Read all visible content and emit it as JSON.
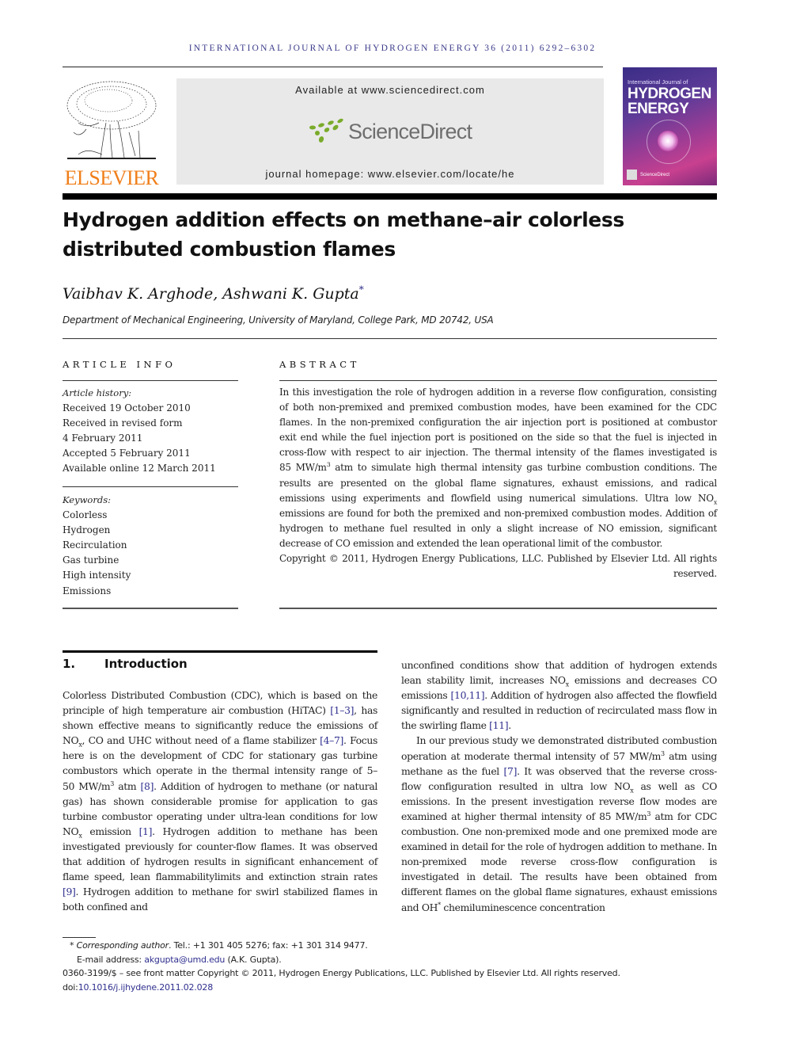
{
  "journal_header": {
    "running_head": "INTERNATIONAL JOURNAL OF HYDROGEN ENERGY 36 (2011) 6292–6302",
    "publisher_logo_text": "ELSEVIER",
    "available_at": "Available at www.sciencedirect.com",
    "sciencedirect_logo_text": "ScienceDirect",
    "journal_homepage": "journal homepage: www.elsevier.com/locate/he",
    "cover": {
      "line1": "International Journal of",
      "line2": "HYDROGEN",
      "line3": "ENERGY",
      "footer": "ScienceDirect"
    },
    "colors": {
      "running_head": "#3b3b8a",
      "elsevier_orange": "#f07f1a",
      "sciencedirect_green": "#7aab2a",
      "sciencedirect_gray": "#6e6e6e",
      "link_blue": "#2f2f8f"
    }
  },
  "article": {
    "title_line1": "Hydrogen addition effects on methane–air colorless",
    "title_line2": "distributed combustion flames",
    "authors": "Vaibhav K. Arghode, Ashwani K. Gupta",
    "corresponding_marker": "*",
    "affiliation": "Department of Mechanical Engineering, University of Maryland, College Park, MD 20742, USA"
  },
  "article_info": {
    "heading": "ARTICLE INFO",
    "history_label": "Article history:",
    "history": [
      "Received 19 October 2010",
      "Received in revised form",
      "4 February 2011",
      "Accepted 5 February 2011",
      "Available online 12 March 2011"
    ],
    "keywords_label": "Keywords:",
    "keywords": [
      "Colorless",
      "Hydrogen",
      "Recirculation",
      "Gas turbine",
      "High intensity",
      "Emissions"
    ]
  },
  "abstract": {
    "heading": "ABSTRACT",
    "p1": "In this investigation the role of hydrogen addition in a reverse flow configuration, con­sisting of both non-premixed and premixed combustion modes, have been examined for the CDC flames. In the non-premixed configuration the air injection port is positioned at combustor exit end while the fuel injection port is positioned on the side so that the fuel is injected in cross-flow with respect to air injection. The thermal intensity of the flames investigated is 85 MW/m",
    "p1_sup": "3",
    "p2": " atm to simulate high thermal intensity gas turbine combustion conditions. The results are presented on the global flame signatures, exhaust emissions, and radical emissions using experiments and flowfield using numerical simulations. Ultra low NO",
    "p2_sub": "x",
    "p3": " emissions are found for both the premixed and non-premixed combustion modes. Addition of hydrogen to methane fuel resulted in only a slight increase of NO emission, significant decrease of CO emission and extended the lean operational limit of the combustor.",
    "copyright": "Copyright © 2011, Hydrogen Energy Publications, LLC. Published by Elsevier Ltd. All rights reserved."
  },
  "introduction": {
    "number": "1.",
    "heading": "Introduction",
    "left": {
      "t1": "Colorless Distributed Combustion (CDC), which is based on the principle of high temperature air combustion (HiTAC) ",
      "r1": "[1–3]",
      "t2": ", has shown effective means to significantly reduce the emis­sions of NO",
      "s1": "x",
      "t3": ", CO and UHC without need of a flame stabilizer ",
      "r2": "[4–7]",
      "t4": ". Focus here is on the development of CDC for stationary gas turbine combustors which operate in the thermal intensity range of 5–50 MW/m",
      "s2": "3",
      "t5": " atm ",
      "r3": "[8]",
      "t6": ". Addition of hydrogen to methane (or natural gas) has shown considerable promise for application to gas turbine combustor operating under ultra-lean conditions for low NO",
      "s3": "x",
      "t7": " emission ",
      "r4": "[1]",
      "t8": ". Hydrogen addition to methane has been investigated previously for counter-flow flames. It was observed that addition of hydrogen results in significant enhancement of flame speed, lean flamma­bilitylimits and extinction strain rates ",
      "r5": "[9]",
      "t9": ". Hydrogen addition to methane for swirl stabilized flames in both confined and"
    },
    "right": {
      "t1": "unconfined conditions show that addition of hydrogen extends lean stability limit, increases NO",
      "s1": "x",
      "t2": " emissions and decreases CO emissions ",
      "r1": "[10,11]",
      "t3": ". Addition of hydrogen also affected the flowfield significantly and resulted in reduction of recirculated mass flow in the swirling flame ",
      "r2": "[11]",
      "t4": ".",
      "p2_t1": "In our previous study we demonstrated distributed combustion operation at moderate thermal intensity of 57 MW/m",
      "p2_s1": "3",
      "p2_t2": " atm using methane as the fuel ",
      "p2_r1": "[7]",
      "p2_t3": ". It was observed that the reverse cross-flow configuration resulted in ultra low NO",
      "p2_s2": "x",
      "p2_t4": " as well as CO emissions. In the present investigation reverse flow modes are examined at higher thermal intensity of 85 MW/m",
      "p2_s3": "3",
      "p2_t5": " atm for CDC combustion. One non-premixed mode and one premixed mode are examined in detail for the role of hydrogen addition to methane. In non-premixed mode reverse cross-flow configuration is investigated in detail. The results have been obtained from different flames on the global flame signatures, exhaust emissions and OH",
      "p2_s4": "*",
      "p2_t6": " chemiluminescence concentration"
    }
  },
  "footnotes": {
    "marker": "*",
    "corresponding_label": "Corresponding author",
    "contact": ". Tel.: +1 301 405 5276; fax: +1 301 314 9477.",
    "email_label": "E-mail address: ",
    "email": "akgupta@umd.edu",
    "email_suffix": " (A.K. Gupta).",
    "issn_line": "0360-3199/$ – see front matter Copyright © 2011, Hydrogen Energy Publications, LLC. Published by Elsevier Ltd. All rights reserved.",
    "doi_label": "doi:",
    "doi": "10.1016/j.ijhydene.2011.02.028"
  }
}
